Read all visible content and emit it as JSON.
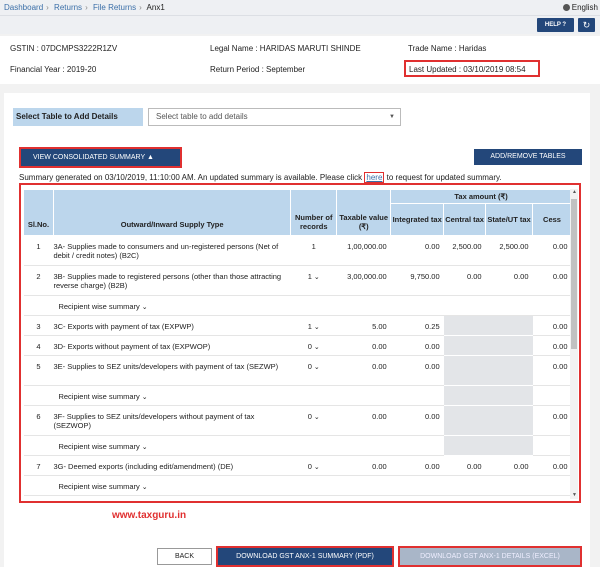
{
  "breadcrumb": [
    "Dashboard",
    "Returns",
    "File Returns",
    "Anx1"
  ],
  "language": "English",
  "help_label": "HELP ?",
  "refresh_glyph": "↻",
  "info": {
    "gstin": "GSTIN : 07DCMPS3222R1ZV",
    "legal_name": "Legal Name : HARIDAS MARUTI SHINDE",
    "trade_name": "Trade Name : Haridas",
    "financial_year": "Financial Year : 2019-20",
    "return_period": "Return Period : September",
    "last_updated": "Last Updated : 03/10/2019 08:54"
  },
  "select_table": {
    "label": "Select Table to Add Details",
    "placeholder": "Select table to add details"
  },
  "view_summary_label": "VIEW CONSOLIDATED SUMMARY ▲",
  "add_remove_label": "ADD/REMOVE TABLES",
  "summary_note": {
    "before": "Summary generated on 03/10/2019, 11:10:00 AM. An updated summary is available. Please click ",
    "link": "here",
    "after": " to request for updated summary."
  },
  "table": {
    "headers": {
      "slno": "Sl.No.",
      "type": "Outward/Inward Supply Type",
      "records": "Number of records",
      "taxable": "Taxable value (₹)",
      "tax_amount": "Tax amount (₹)",
      "integrated": "Integrated tax",
      "central": "Central tax",
      "state": "State/UT tax",
      "cess": "Cess"
    },
    "recipient_label": "Recipient wise summary",
    "rows": [
      {
        "sl": "1",
        "type": "3A- Supplies made to consumers and un-registered persons (Net of debit / credit notes) (B2C)",
        "records": "1",
        "taxable": "1,00,000.00",
        "igst": "0.00",
        "cgst": "2,500.00",
        "sgst": "2,500.00",
        "cess": "0.00"
      },
      {
        "sl": "2",
        "type": "3B- Supplies made to registered persons (other than those attracting reverse charge) (B2B)",
        "records": "1",
        "taxable": "3,00,000.00",
        "igst": "9,750.00",
        "cgst": "0.00",
        "sgst": "0.00",
        "cess": "0.00"
      },
      {
        "sl": "3",
        "type": "3C- Exports with payment of tax (EXPWP)",
        "records": "1",
        "taxable": "5.00",
        "igst": "0.25",
        "cess": "0.00"
      },
      {
        "sl": "4",
        "type": "3D- Exports without payment of tax (EXPWOP)",
        "records": "0",
        "taxable": "0.00",
        "igst": "0.00",
        "cess": "0.00"
      },
      {
        "sl": "5",
        "type": "3E- Supplies to SEZ units/developers with payment of tax (SEZWP)",
        "records": "0",
        "taxable": "0.00",
        "igst": "0.00",
        "cess": "0.00"
      },
      {
        "sl": "6",
        "type": "3F- Supplies to SEZ units/developers without payment of tax (SEZWOP)",
        "records": "0",
        "taxable": "0.00",
        "igst": "0.00",
        "cess": "0.00"
      },
      {
        "sl": "7",
        "type": "3G- Deemed exports (including edit/amendment) (DE)",
        "records": "0",
        "taxable": "0.00",
        "igst": "0.00",
        "cgst": "0.00",
        "sgst": "0.00",
        "cess": "0.00"
      }
    ]
  },
  "watermark": "www.taxguru.in",
  "buttons": {
    "back": "BACK",
    "download_summary": "DOWNLOAD GST ANX-1 SUMMARY (PDF)",
    "download_details": "DOWNLOAD GST ANX-1 DETAILS (EXCEL)"
  }
}
